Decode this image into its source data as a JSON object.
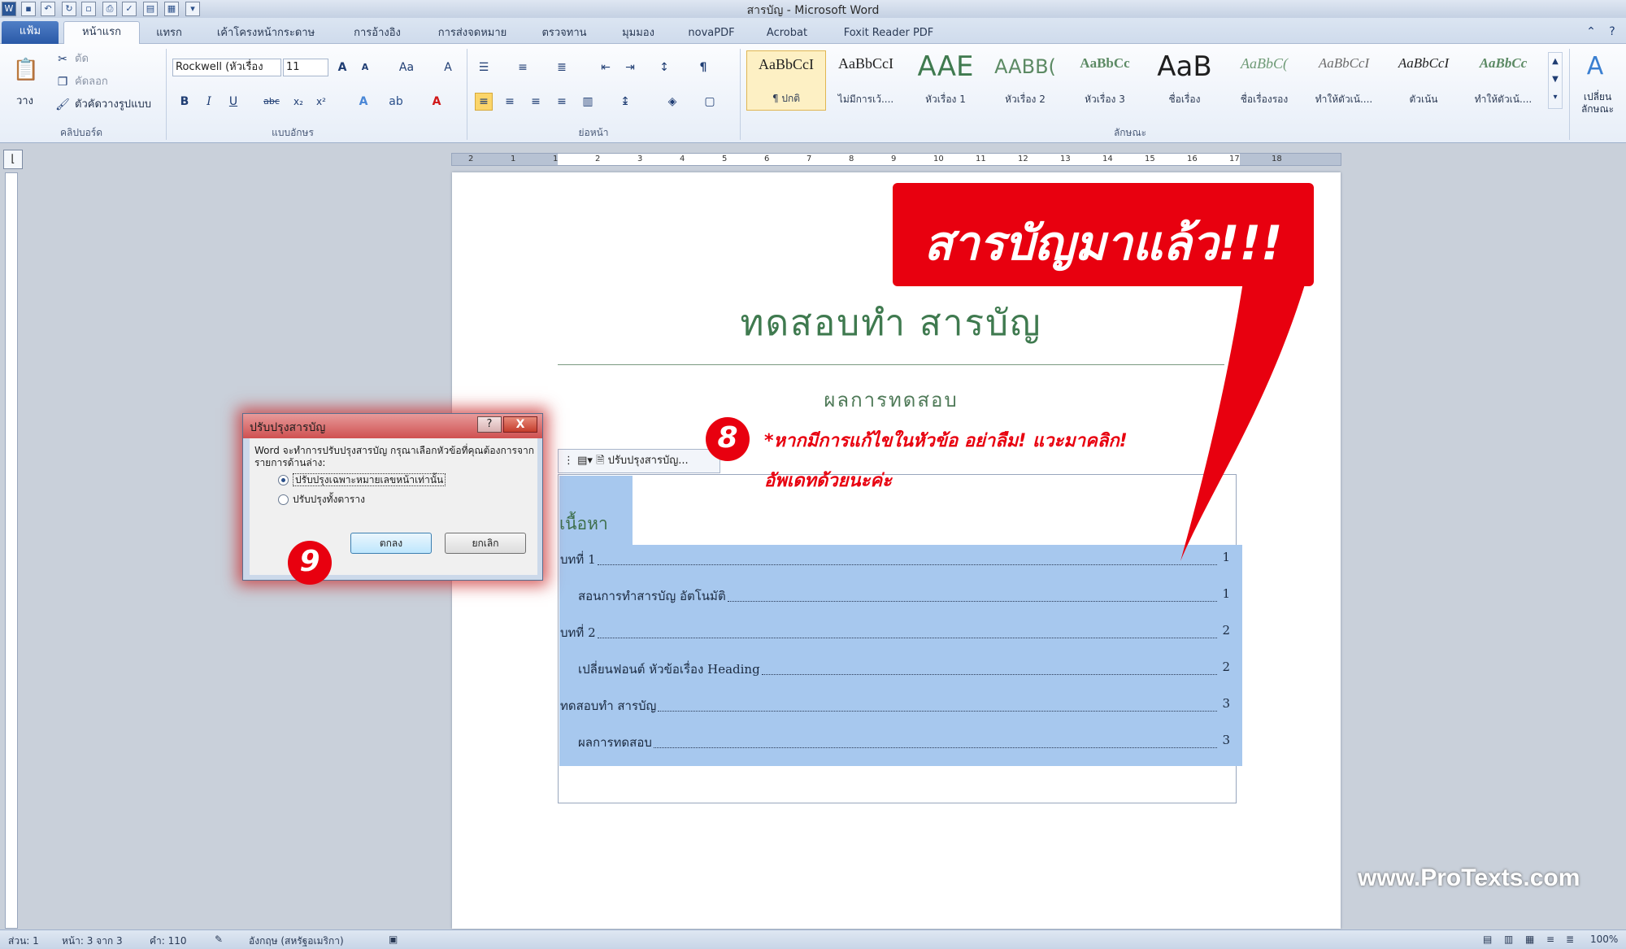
{
  "window": {
    "title": "สารบัญ - Microsoft Word"
  },
  "tabs": [
    {
      "label": "แฟ้ม"
    },
    {
      "label": "หน้าแรก"
    },
    {
      "label": "แทรก"
    },
    {
      "label": "เค้าโครงหน้ากระดาษ"
    },
    {
      "label": "การอ้างอิง"
    },
    {
      "label": "การส่งจดหมาย"
    },
    {
      "label": "ตรวจทาน"
    },
    {
      "label": "มุมมอง"
    },
    {
      "label": "novaPDF"
    },
    {
      "label": "Acrobat"
    },
    {
      "label": "Foxit Reader PDF"
    }
  ],
  "ribbon": {
    "clipboard": {
      "paste": "วาง",
      "cut": "ตัด",
      "copy": "คัดลอก",
      "format_painter": "ตัวคัดวางรูปแบบ",
      "label": "คลิปบอร์ด"
    },
    "font": {
      "name": "Rockwell (หัวเรื่อง",
      "size": "11",
      "label": "แบบอักษร",
      "bold": "B",
      "italic": "I",
      "underline": "U",
      "strike": "abc",
      "sub": "x₂",
      "sup": "x²",
      "grow": "A",
      "shrink": "A",
      "case": "Aa"
    },
    "paragraph": {
      "label": "ย่อหน้า",
      "pilcrow": "¶"
    },
    "styles": {
      "label": "ลักษณะ",
      "change_styles": "เปลี่ยน ลักษณะ",
      "items": [
        {
          "sample": "AaBbCcI",
          "name": "¶ ปกติ"
        },
        {
          "sample": "AaBbCcI",
          "name": "ไม่มีการเว้...."
        },
        {
          "sample": "AAE",
          "name": "หัวเรื่อง 1"
        },
        {
          "sample": "AABB(",
          "name": "หัวเรื่อง 2"
        },
        {
          "sample": "AaBbCc",
          "name": "หัวเรื่อง 3"
        },
        {
          "sample": "AaB",
          "name": "ชื่อเรื่อง"
        },
        {
          "sample": "AaBbC(",
          "name": "ชื่อเรื่องรอง"
        },
        {
          "sample": "AaBbCcI",
          "name": "ทำให้ตัวเน้...."
        },
        {
          "sample": "AaBbCcI",
          "name": "ตัวเน้น"
        },
        {
          "sample": "AaBbCc",
          "name": "ทำให้ตัวเน้...."
        }
      ]
    }
  },
  "ruler": {
    "ticks": [
      "2",
      "1",
      "1",
      "2",
      "3",
      "4",
      "5",
      "6",
      "7",
      "8",
      "9",
      "10",
      "11",
      "12",
      "13",
      "14",
      "15",
      "16",
      "17",
      "18"
    ]
  },
  "document": {
    "title": "ทดสอบทำ สารบัญ",
    "subtitle": "ผลการทดสอบ",
    "toc_handle": "ปรับปรุงสารบัญ...",
    "toc_heading": "เนื้อหา",
    "toc_entries": [
      {
        "text": "บทที่ 1",
        "page": "1",
        "level": 1
      },
      {
        "text": "สอนการทำสารบัญ อัตโนมัติ",
        "page": "1",
        "level": 2
      },
      {
        "text": "บทที่ 2",
        "page": "2",
        "level": 1
      },
      {
        "text": "เปลี่ยนฟอนต์ หัวข้อเรื่อง Heading",
        "page": "2",
        "level": 2
      },
      {
        "text": "ทดสอบทำ สารบัญ",
        "page": "3",
        "level": 1
      },
      {
        "text": "ผลการทดสอบ",
        "page": "3",
        "level": 2
      }
    ]
  },
  "dialog": {
    "title": "ปรับปรุงสารบัญ",
    "help": "?",
    "close": "X",
    "message": "Word จะทำการปรับปรุงสารบัญ กรุณาเลือกหัวข้อที่คุณต้องการจากรายการด้านล่าง:",
    "option1": "ปรับปรุงเฉพาะหมายเลขหน้าเท่านั้น",
    "option2": "ปรับปรุงทั้งตาราง",
    "ok": "ตกลง",
    "cancel": "ยกเลิก"
  },
  "annotations": {
    "callout": "สารบัญมาแล้ว!!!",
    "step8": "8",
    "step9": "9",
    "note_line1": "*หากมีการแก้ไขในหัวข้อ อย่าลืม! แวะมาคลิก!",
    "note_line2": "อัพเดทด้วยนะค่ะ",
    "watermark": "www.ProTexts.com",
    "accent": "#e8000f"
  },
  "statusbar": {
    "section": "ส่วน: 1",
    "page": "หน้า: 3 จาก 3",
    "words": "คำ: 110",
    "language": "อังกฤษ (สหรัฐอเมริกา)",
    "zoom": "100%"
  }
}
